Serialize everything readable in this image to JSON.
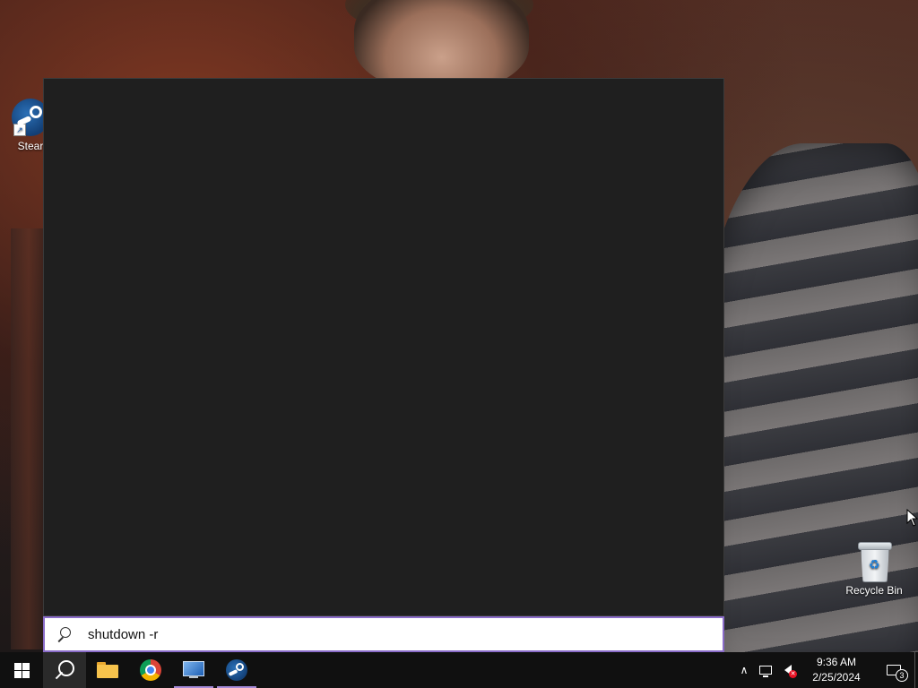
{
  "desktop": {
    "icons": [
      {
        "label": "Stear"
      },
      {
        "label": "Recycle Bin"
      }
    ]
  },
  "search": {
    "query": "shutdown -r",
    "border_color": "#8a6cc9"
  },
  "taskbar": {
    "apps": [
      {
        "icon": "windows-start-icon",
        "state": "idle"
      },
      {
        "icon": "search-icon",
        "state": "active"
      },
      {
        "icon": "file-explorer-icon",
        "state": "idle"
      },
      {
        "icon": "chrome-icon",
        "state": "idle"
      },
      {
        "icon": "remote-desktop-icon",
        "state": "running"
      },
      {
        "icon": "steam-icon",
        "state": "running"
      }
    ],
    "running_indicator_color": "#a58ad8",
    "tray": {
      "time": "9:36 AM",
      "date": "2/25/2024",
      "notification_count": "3"
    }
  }
}
